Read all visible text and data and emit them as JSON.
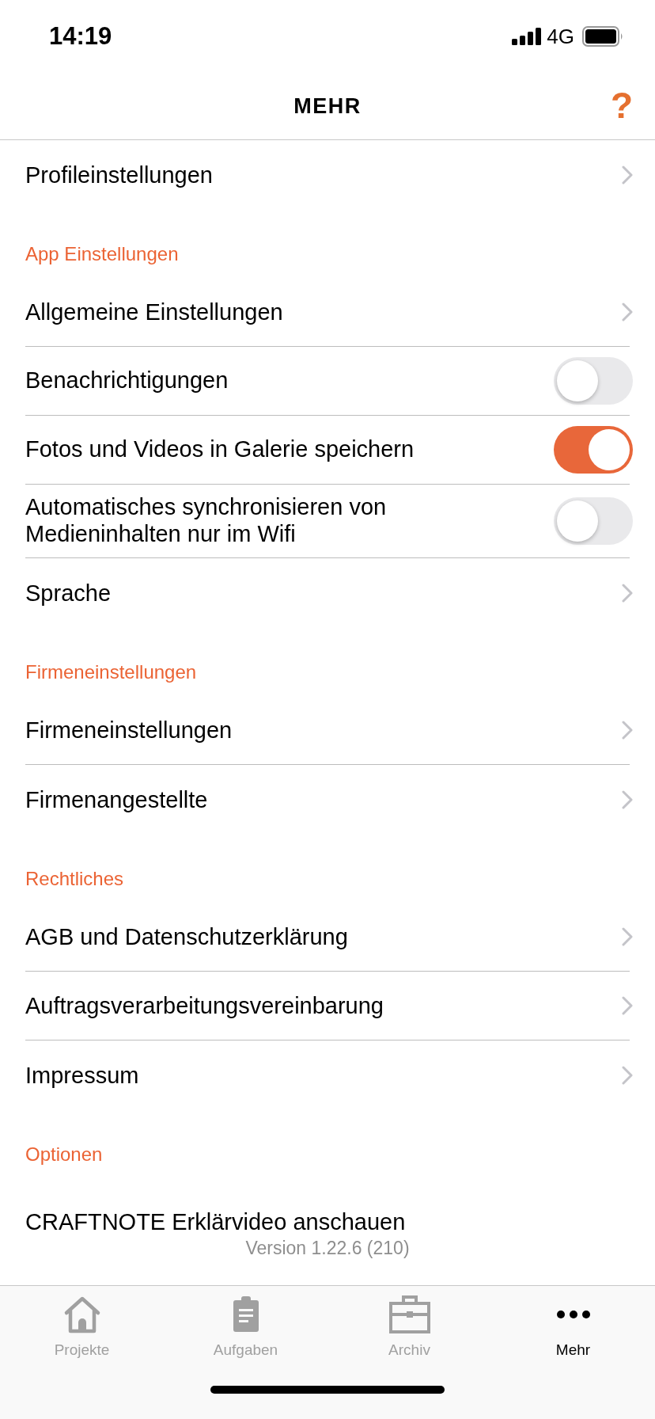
{
  "status_bar": {
    "time": "14:19",
    "network": "4G"
  },
  "header": {
    "title": "MEHR",
    "help": "?"
  },
  "sections": [
    {
      "items": [
        {
          "kind": "link",
          "label": "Profileinstellungen"
        }
      ]
    },
    {
      "title": "App Einstellungen",
      "items": [
        {
          "kind": "link",
          "label": "Allgemeine Einstellungen"
        },
        {
          "kind": "toggle",
          "label": "Benachrichtigungen",
          "on": false
        },
        {
          "kind": "toggle",
          "label": "Fotos und Videos in Galerie speichern",
          "on": true
        },
        {
          "kind": "toggle",
          "label": "Automatisches synchronisieren von Medieninhalten nur im Wifi",
          "on": false
        },
        {
          "kind": "link",
          "label": "Sprache"
        }
      ]
    },
    {
      "title": "Firmeneinstellungen",
      "items": [
        {
          "kind": "link",
          "label": "Firmeneinstellungen"
        },
        {
          "kind": "link",
          "label": "Firmenangestellte"
        }
      ]
    },
    {
      "title": "Rechtliches",
      "items": [
        {
          "kind": "link",
          "label": "AGB und Datenschutzerklärung"
        },
        {
          "kind": "link",
          "label": "Auftragsverarbeitungsvereinbarung"
        },
        {
          "kind": "link",
          "label": "Impressum"
        }
      ]
    },
    {
      "title": "Optionen",
      "items": [
        {
          "kind": "plain",
          "label": "CRAFTNOTE Erklärvideo anschauen"
        }
      ]
    }
  ],
  "version": "Version 1.22.6 (210)",
  "tabs": [
    {
      "label": "Projekte",
      "selected": false
    },
    {
      "label": "Aufgaben",
      "selected": false
    },
    {
      "label": "Archiv",
      "selected": false
    },
    {
      "label": "Mehr",
      "selected": true
    }
  ]
}
